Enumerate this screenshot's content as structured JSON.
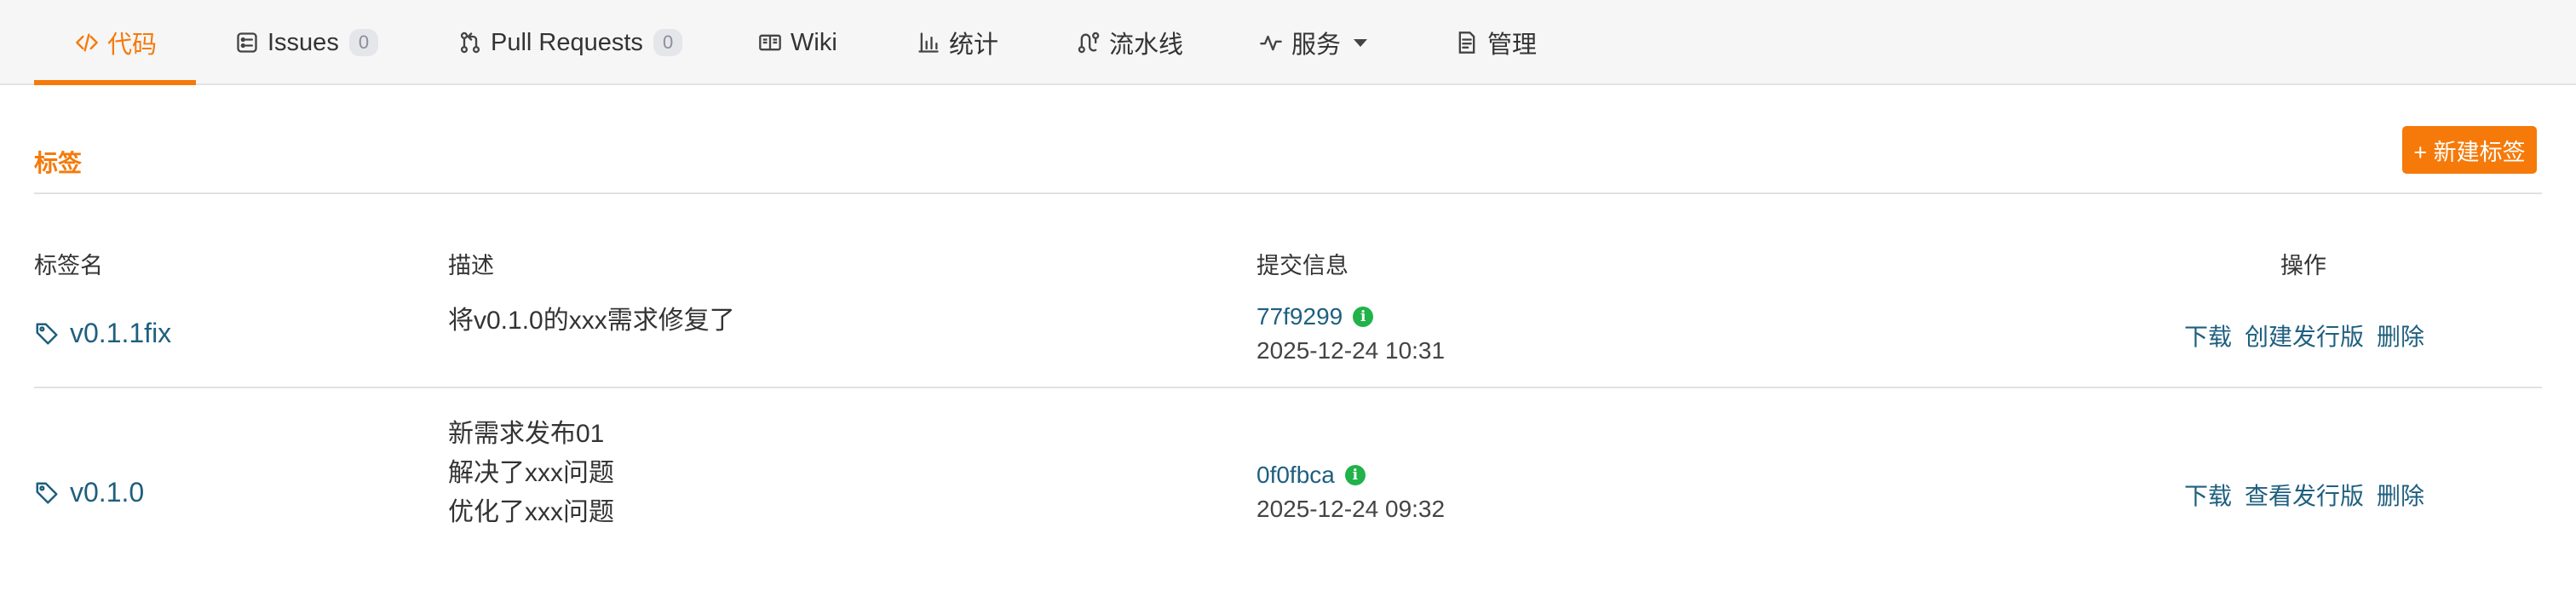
{
  "tabs": [
    {
      "label": "代码",
      "icon": "code-icon",
      "active": true
    },
    {
      "label": "Issues",
      "icon": "issues-icon",
      "count": "0"
    },
    {
      "label": "Pull Requests",
      "icon": "pull-request-icon",
      "count": "0"
    },
    {
      "label": "Wiki",
      "icon": "book-icon"
    },
    {
      "label": "统计",
      "icon": "bar-chart-icon"
    },
    {
      "label": "流水线",
      "icon": "pipeline-icon"
    },
    {
      "label": "服务",
      "icon": "pulse-icon",
      "dropdown_icon": "caret-down-icon"
    },
    {
      "label": "管理",
      "icon": "document-icon"
    }
  ],
  "section": {
    "title": "标签",
    "new_button": "+ 新建标签"
  },
  "table": {
    "headers": {
      "name": "标签名",
      "description": "描述",
      "commit": "提交信息",
      "actions": "操作"
    },
    "rows": [
      {
        "tag": "v0.1.1fix",
        "description": [
          "将v0.1.0的xxx需求修复了"
        ],
        "commit_hash": "77f9299",
        "commit_time": "2025-12-24 10:31",
        "actions": [
          "下载",
          "创建发行版",
          "删除"
        ]
      },
      {
        "tag": "v0.1.0",
        "description": [
          "新需求发布01",
          "解决了xxx问题",
          "优化了xxx问题"
        ],
        "commit_hash": "0f0fbca",
        "commit_time": "2025-12-24 09:32",
        "actions": [
          "下载",
          "查看发行版",
          "删除"
        ]
      }
    ]
  },
  "colors": {
    "accent": "#f57a0a",
    "link": "#1f5f7f",
    "info_badge": "#21b24a"
  }
}
